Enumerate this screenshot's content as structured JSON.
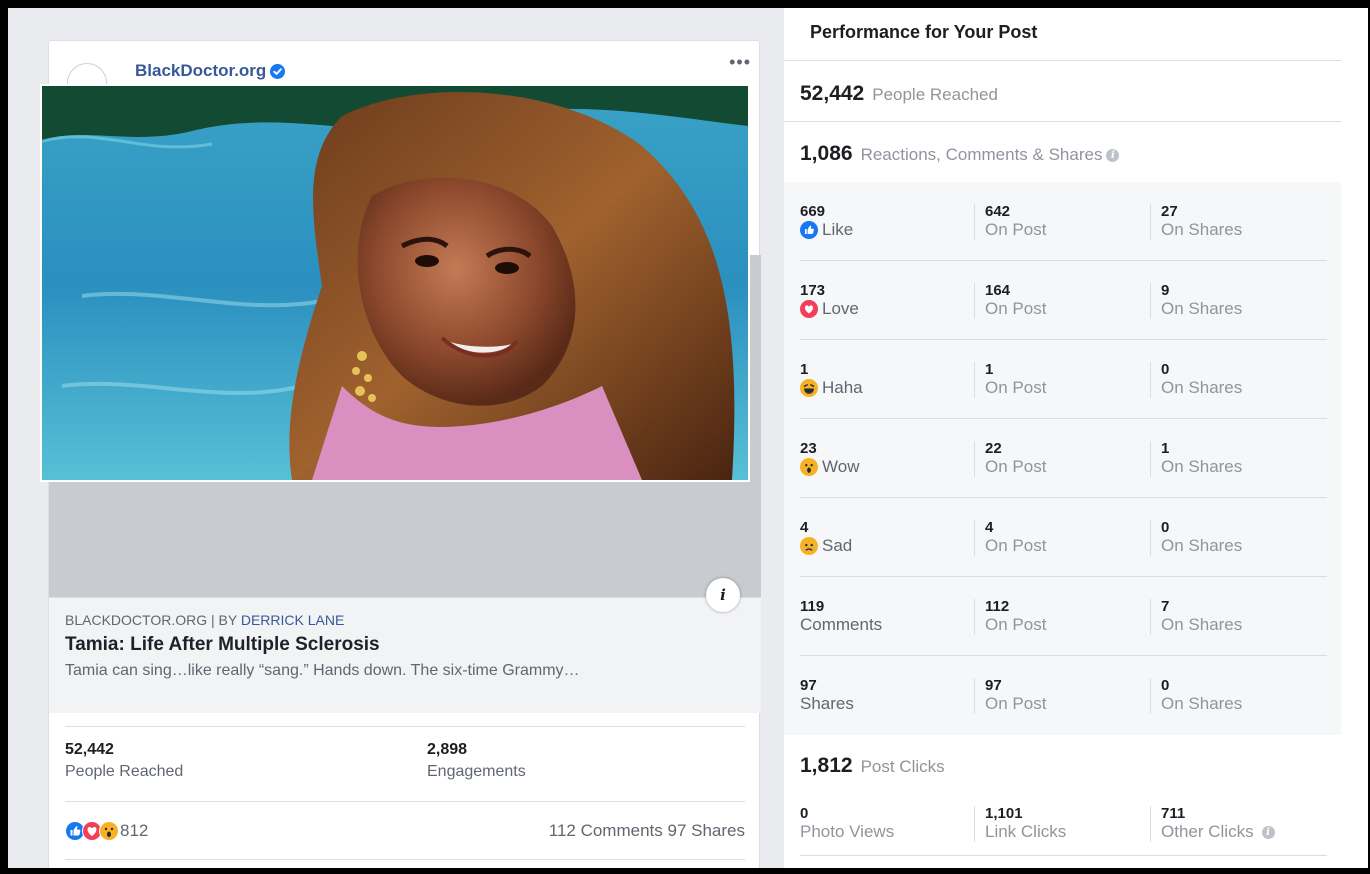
{
  "post": {
    "page_name": "BlackDoctor.org",
    "more_label": "•••",
    "info_label": "i",
    "link": {
      "source": "BLACKDOCTOR.ORG",
      "separator": " | BY ",
      "author": "DERRICK LANE",
      "title": "Tamia: Life After Multiple Sclerosis",
      "description": "Tamia can sing…like really “sang.” Hands down. The six-time Grammy…"
    },
    "stats": {
      "reached_value": "52,442",
      "reached_label": "People Reached",
      "engagements_value": "2,898",
      "engagements_label": "Engagements"
    },
    "reactions": {
      "count": "812",
      "comments": "112 Comments",
      "shares": "97 Shares"
    }
  },
  "performance": {
    "title": "Performance for Your Post",
    "people_reached_value": "52,442",
    "people_reached_label": "People Reached",
    "rcs_value": "1,086",
    "rcs_label": "Reactions, Comments & Shares",
    "rows": [
      {
        "total": "669",
        "label": "Like",
        "icon": "like-icon",
        "on_post": "642",
        "on_shares": "27"
      },
      {
        "total": "173",
        "label": "Love",
        "icon": "love-icon",
        "on_post": "164",
        "on_shares": "9"
      },
      {
        "total": "1",
        "label": "Haha",
        "icon": "haha-icon",
        "on_post": "1",
        "on_shares": "0"
      },
      {
        "total": "23",
        "label": "Wow",
        "icon": "wow-icon",
        "on_post": "22",
        "on_shares": "1"
      },
      {
        "total": "4",
        "label": "Sad",
        "icon": "sad-icon",
        "on_post": "4",
        "on_shares": "0"
      },
      {
        "total": "119",
        "label": "Comments",
        "icon": "",
        "on_post": "112",
        "on_shares": "7"
      },
      {
        "total": "97",
        "label": "Shares",
        "icon": "",
        "on_post": "97",
        "on_shares": "0"
      }
    ],
    "on_post_label": "On Post",
    "on_shares_label": "On Shares",
    "post_clicks_value": "1,812",
    "post_clicks_label": "Post Clicks",
    "clicks": {
      "photo_views_value": "0",
      "photo_views_label": "Photo Views",
      "link_clicks_value": "1,101",
      "link_clicks_label": "Link Clicks",
      "other_clicks_value": "711",
      "other_clicks_label": "Other Clicks"
    }
  },
  "colors": {
    "link_blue": "#385898",
    "like_blue": "#1877f2",
    "love_red": "#f33e58",
    "emoji_yellow": "#f7b125"
  }
}
